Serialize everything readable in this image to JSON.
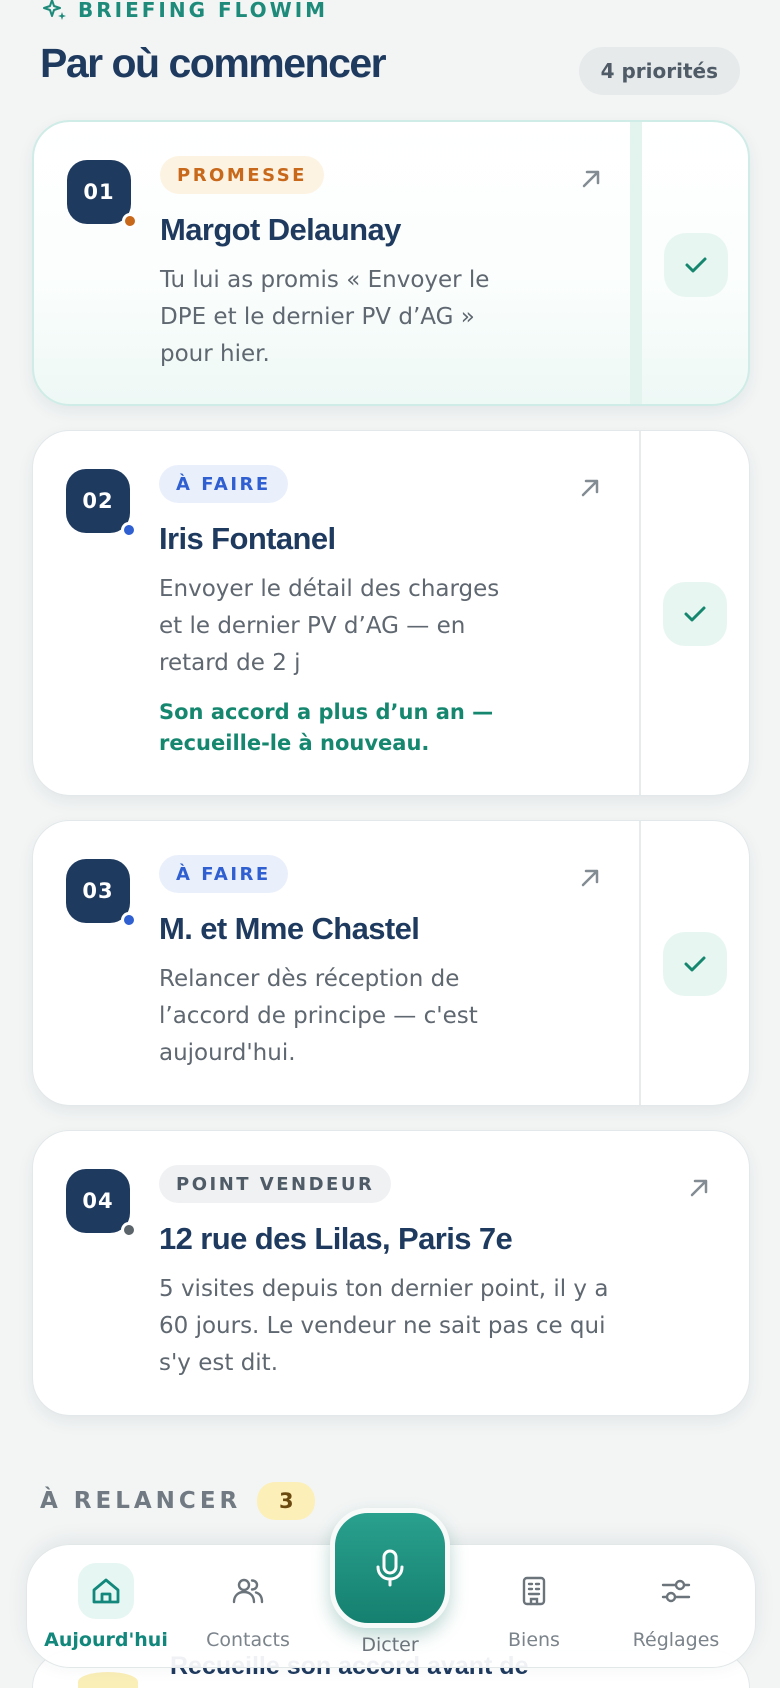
{
  "header": {
    "eyebrow": "BRIEFING FLOWIM",
    "title": "Par où commencer",
    "count": "4 priorités"
  },
  "colors": {
    "navy": "#1f3a5f",
    "teal": "#16876f",
    "promise": "#c7681b",
    "todo": "#2f5fd0",
    "neutral": "#4f5b66"
  },
  "cards": [
    {
      "num": "01",
      "tag": "PROMESSE",
      "name": "Margot Delaunay",
      "desc": [
        "Tu lui as promis « Envoyer le",
        "DPE et le dernier PV d’AG »",
        "pour hier."
      ],
      "dot_color": "#c7681b",
      "done_icon": "check-icon"
    },
    {
      "num": "02",
      "tag": "À FAIRE",
      "name": "Iris Fontanel",
      "desc": [
        "Envoyer le détail des charges",
        "et le dernier PV d’AG — en",
        "retard de 2 j"
      ],
      "note": [
        "Son accord a plus d’un an —",
        "recueille-le à nouveau."
      ],
      "dot_color": "#2f5fd0",
      "done_icon": "check-icon"
    },
    {
      "num": "03",
      "tag": "À FAIRE",
      "name": "M. et Mme Chastel",
      "desc": [
        "Relancer dès réception de",
        "l’accord de principe — c'est",
        "aujourd'hui."
      ],
      "dot_color": "#2f5fd0",
      "done_icon": "check-icon"
    },
    {
      "num": "04",
      "tag": "POINT VENDEUR",
      "name": "12 rue des Lilas, Paris 7e",
      "desc": [
        "5 visites depuis ton dernier point, il y a",
        "60 jours. Le vendeur ne sait pas ce qui",
        "s'y est dit."
      ],
      "dot_color": "#5b636b"
    }
  ],
  "followup": {
    "label": "À RELANCER",
    "count": "3",
    "peek_text": "Recueille son accord avant de"
  },
  "nav": {
    "home": "Aujourd'hui",
    "contacts": "Contacts",
    "dictate": "Dicter",
    "properties": "Biens",
    "settings": "Réglages"
  }
}
